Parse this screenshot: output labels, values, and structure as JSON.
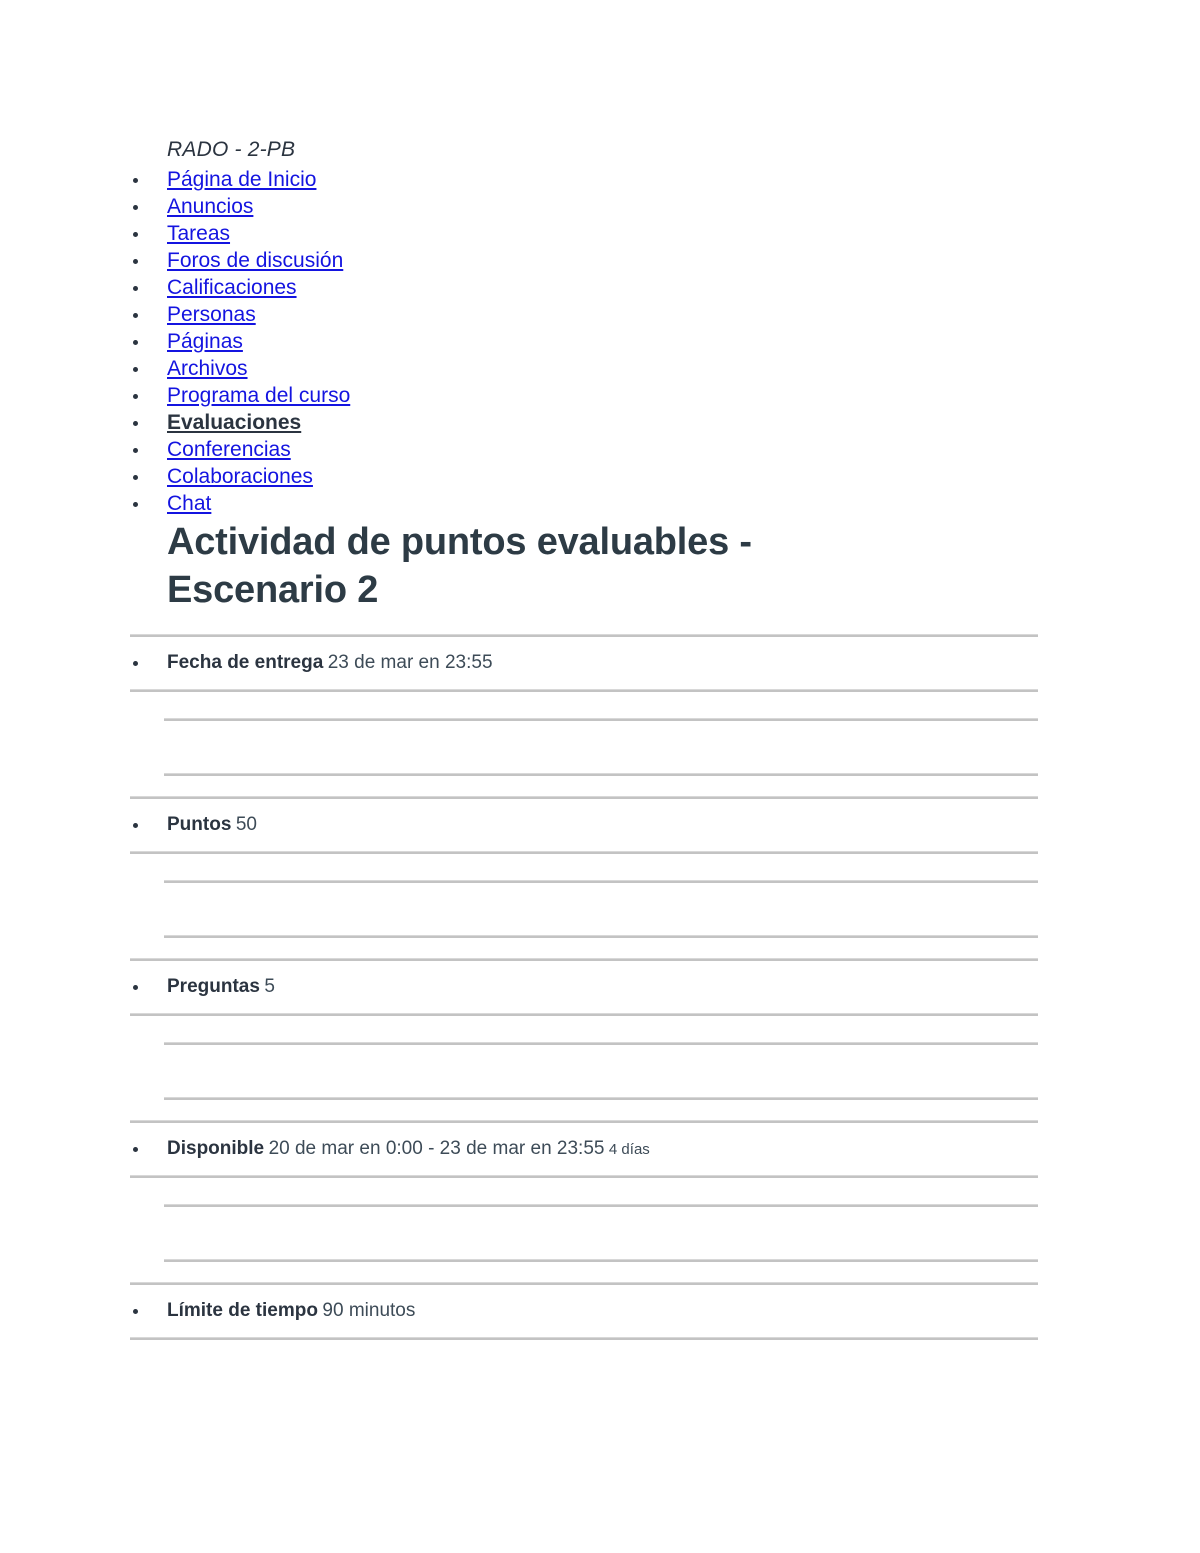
{
  "course": {
    "name": "RADO - 2-PB"
  },
  "nav": {
    "items": [
      {
        "label": "Página de Inicio",
        "current": false
      },
      {
        "label": "Anuncios",
        "current": false
      },
      {
        "label": "Tareas",
        "current": false
      },
      {
        "label": "Foros de discusión",
        "current": false
      },
      {
        "label": "Calificaciones",
        "current": false
      },
      {
        "label": "Personas",
        "current": false
      },
      {
        "label": "Páginas",
        "current": false
      },
      {
        "label": "Archivos",
        "current": false
      },
      {
        "label": "Programa del curso",
        "current": false
      },
      {
        "label": "Evaluaciones",
        "current": true
      },
      {
        "label": "Conferencias",
        "current": false
      },
      {
        "label": "Colaboraciones",
        "current": false
      },
      {
        "label": "Chat",
        "current": false
      }
    ]
  },
  "assignment": {
    "title": "Actividad de puntos evaluables - Escenario 2",
    "details": [
      {
        "label": "Fecha de entrega",
        "value": "23 de mar en 23:55",
        "note": ""
      },
      {
        "label": "Puntos",
        "value": "50",
        "note": ""
      },
      {
        "label": "Preguntas",
        "value": "5",
        "note": ""
      },
      {
        "label": "Disponible",
        "value": "20 de mar en 0:00 - 23 de mar en 23:55",
        "note": "4 días"
      },
      {
        "label": "Límite de tiempo",
        "value": "90 minutos",
        "note": ""
      }
    ]
  },
  "colors": {
    "link": "#1414e0",
    "text": "#2b3440",
    "rule": "#c3c3c3"
  }
}
